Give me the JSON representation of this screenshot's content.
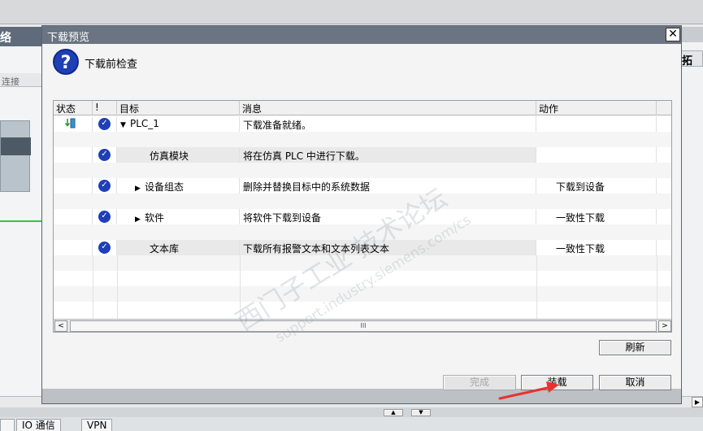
{
  "background": {
    "left_header": "络",
    "left_tab": "连接",
    "right_tab": "拓",
    "bottom_tabs": [
      "IO 通信",
      "VPN"
    ]
  },
  "dialog": {
    "title": "下载预览",
    "header_title": "下载前检查",
    "columns": {
      "status": "状态",
      "flag": "!",
      "target": "目标",
      "message": "消息",
      "action": "动作"
    },
    "rows": [
      {
        "name": "PLC_1",
        "expand": "▼",
        "message": "下载准备就绪。",
        "action": ""
      },
      {
        "name": "仿真模块",
        "expand": "",
        "message": "将在仿真 PLC 中进行下载。",
        "action": ""
      },
      {
        "name": "设备组态",
        "expand": "▶",
        "message": "删除并替换目标中的系统数据",
        "action": "下载到设备"
      },
      {
        "name": "软件",
        "expand": "▶",
        "message": "将软件下载到设备",
        "action": "一致性下载"
      },
      {
        "name": "文本库",
        "expand": "",
        "message": "下载所有报警文本和文本列表文本",
        "action": "一致性下载"
      }
    ],
    "scroll_left": "<",
    "scroll_right": ">",
    "scroll_grip": "III",
    "buttons": {
      "refresh": "刷新",
      "finish": "完成",
      "load": "装载",
      "cancel": "取消"
    }
  },
  "watermark": {
    "line1": "西门子工业 技术论坛",
    "line2": "support.industry.siemens.com/cs"
  },
  "colors": {
    "titlebar": "#6a7482",
    "check": "#1e3fb8",
    "arrow": "#e8322f"
  }
}
